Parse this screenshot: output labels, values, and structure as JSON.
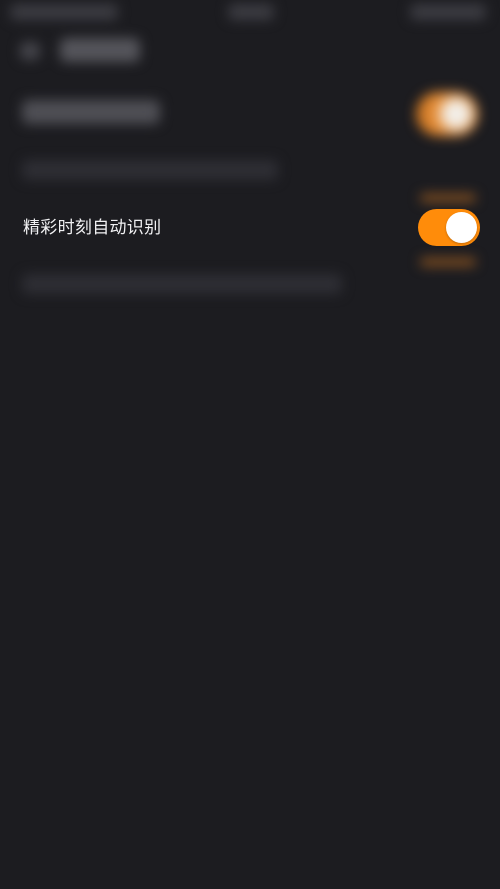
{
  "setting": {
    "label": "精彩时刻自动识别",
    "enabled": true
  },
  "colors": {
    "background": "#1c1c20",
    "accent": "#ff8c0a",
    "text": "#f1f1f3"
  }
}
